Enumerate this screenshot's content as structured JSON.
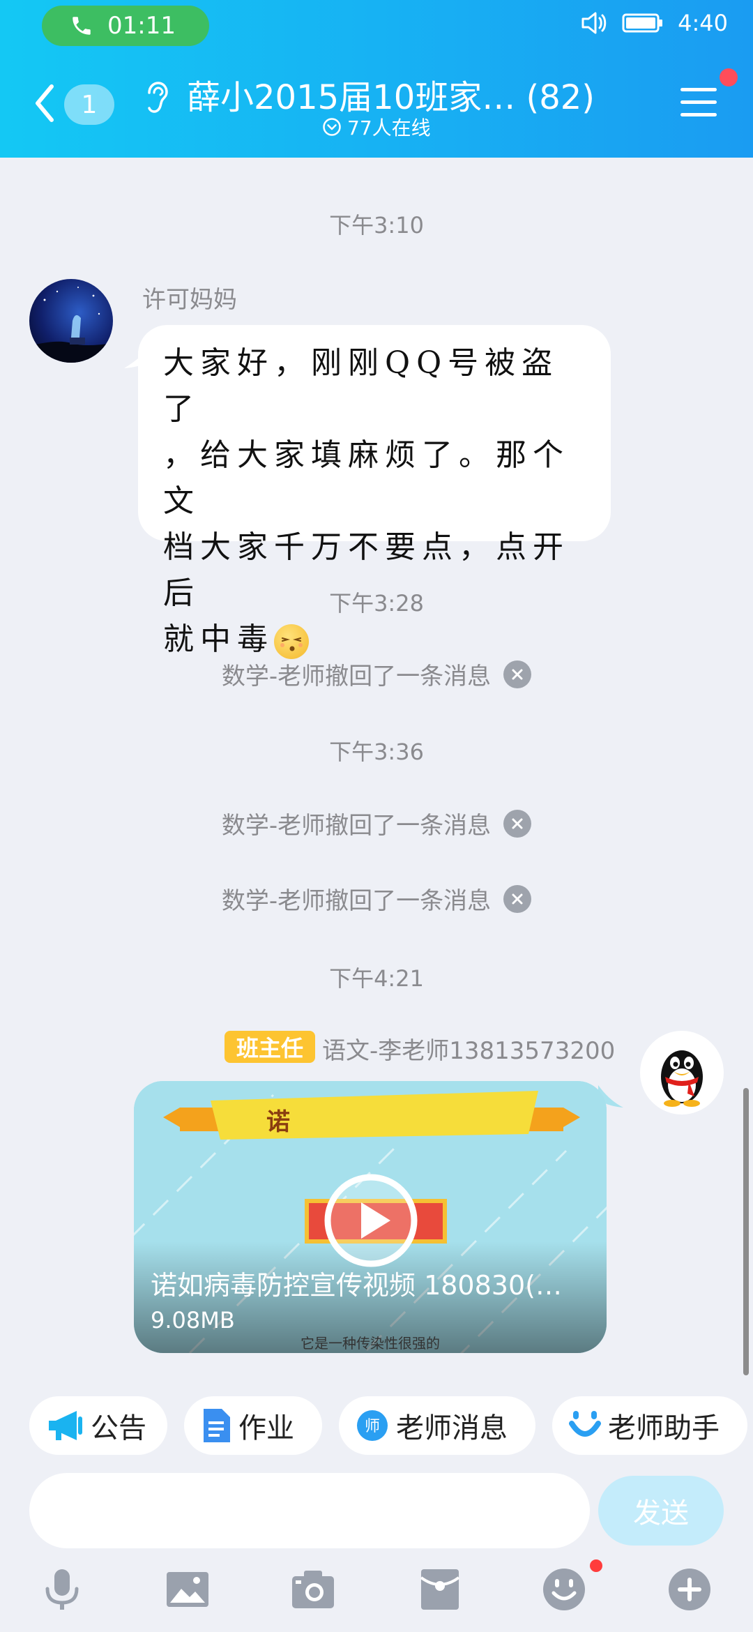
{
  "status_bar": {
    "call_time": "01:11",
    "time": "4:40"
  },
  "header": {
    "back_count": "1",
    "title": "薛小2015届10班家… (82)",
    "online": "77人在线"
  },
  "messages": {
    "time1": "下午3:10",
    "sender1": "许可妈妈",
    "text1_line1": "大家好，刚刚QQ号被盗了",
    "text1_line2": "，给大家填麻烦了。那个文",
    "text1_line3": "档大家千万不要点，点开后",
    "text1_line4": "就中毒",
    "time2": "下午3:28",
    "recall1": "数学-老师撤回了一条消息",
    "time3": "下午3:36",
    "recall2": "数学-老师撤回了一条消息",
    "recall3": "数学-老师撤回了一条消息",
    "time4": "下午4:21",
    "role_tag": "班主任",
    "sender2": "语文-李老师13813573200",
    "video_banner": "诺",
    "video_title": "诺如病毒防控宣传视频  180830(…",
    "video_size": "9.08MB",
    "video_subtitle": "它是一种传染性很强的"
  },
  "quick_actions": {
    "notice": "公告",
    "homework": "作业",
    "teacher_msg_badge": "师",
    "teacher_msg": "老师消息",
    "teacher_helper": "老师助手"
  },
  "input": {
    "placeholder": "",
    "send": "发送"
  },
  "colors": {
    "header_start": "#14c8f4",
    "header_end": "#1a9cf2",
    "call_green": "#3dbe62",
    "role_tag": "#fdc431",
    "send_disabled": "#c4ecfb",
    "notification_dot": "#ff4d5a"
  },
  "icons": {
    "toolbar": [
      "microphone-icon",
      "image-icon",
      "camera-icon",
      "red-packet-icon",
      "emoji-icon",
      "plus-icon"
    ]
  }
}
